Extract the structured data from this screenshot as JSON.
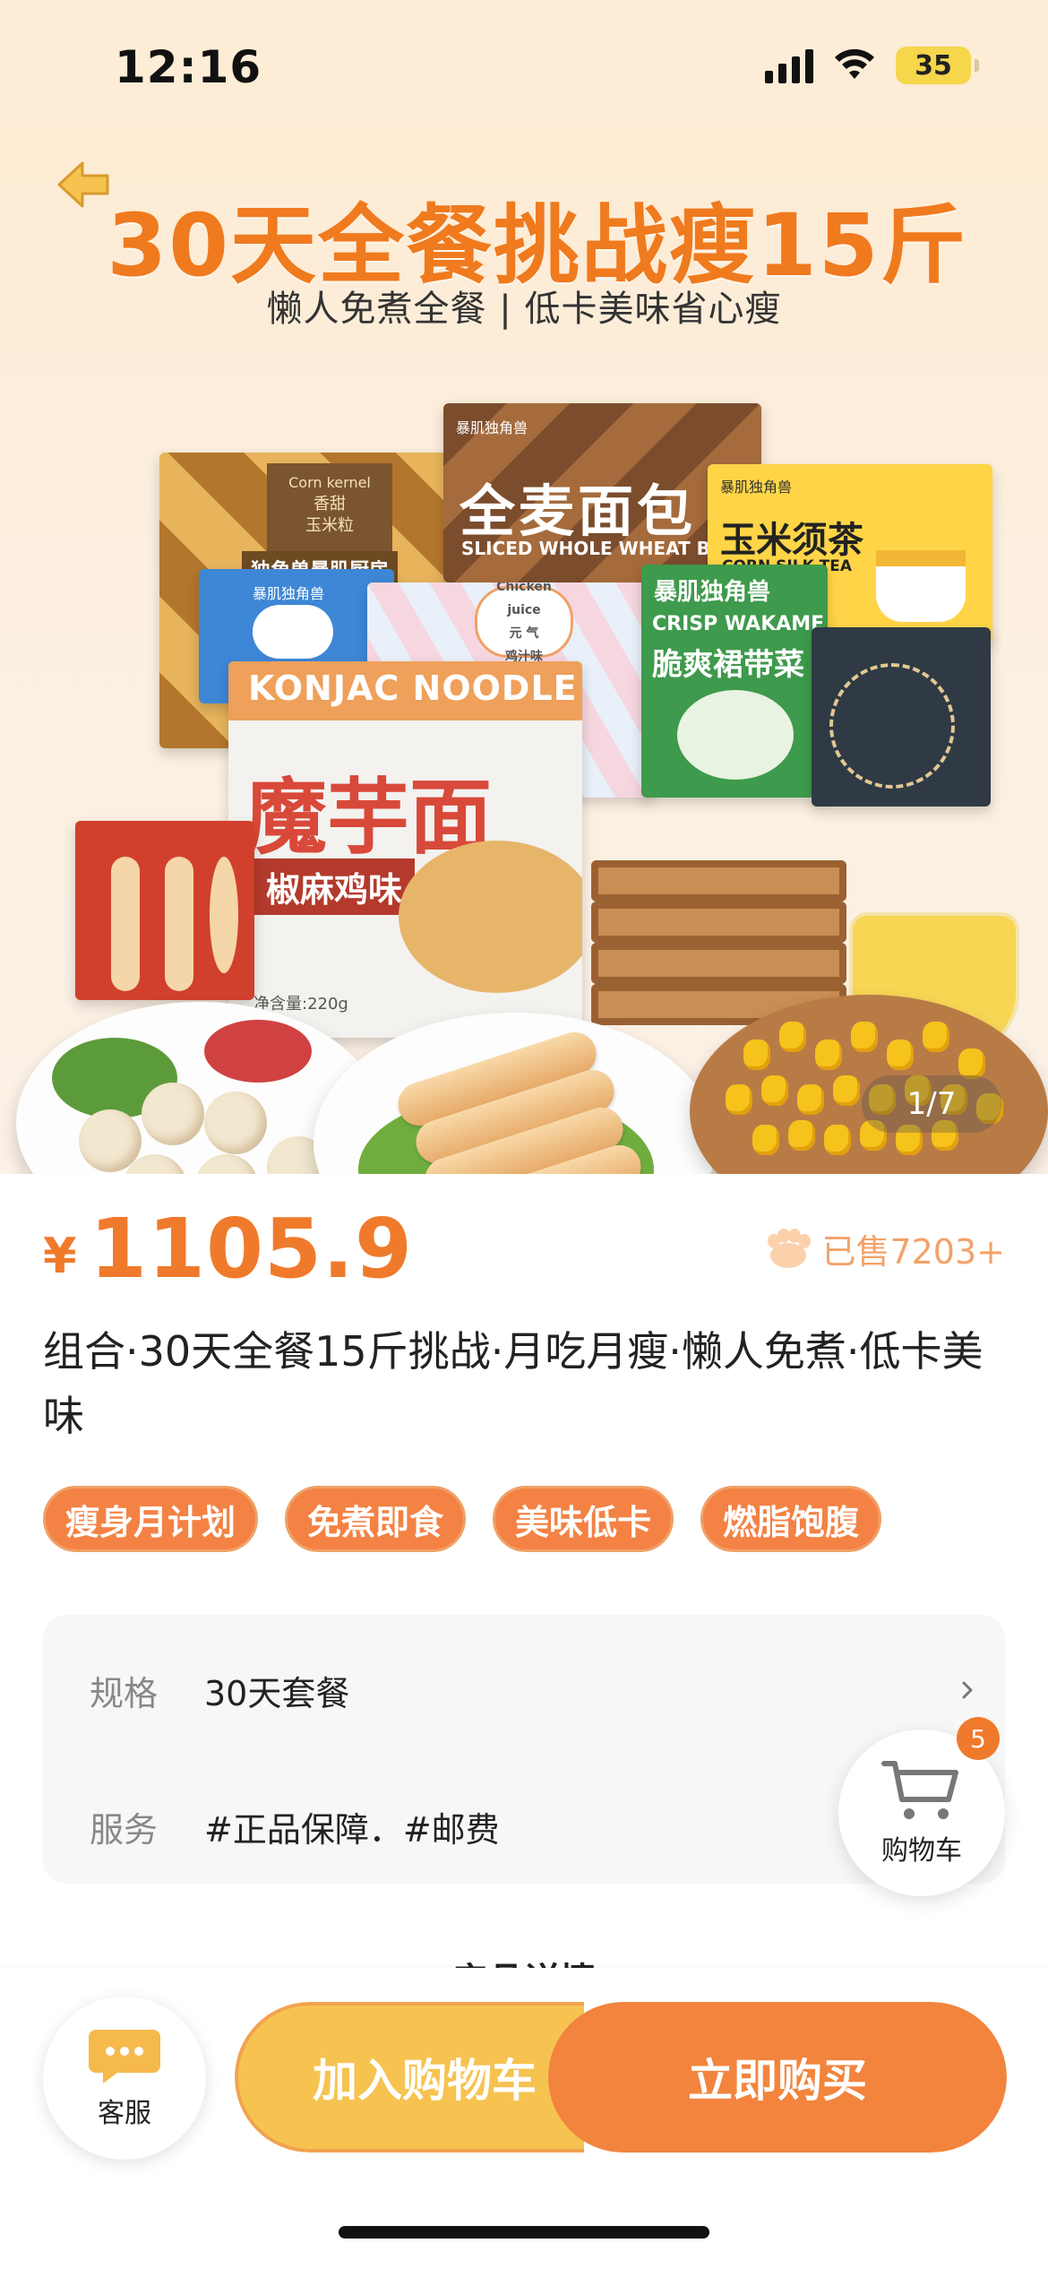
{
  "status_bar": {
    "time": "12:16",
    "battery": "35"
  },
  "banner": {
    "title": "30天全餐挑战瘦15斤",
    "subtitle": "懒人免煮全餐 | 低卡美味省心瘦",
    "packages": {
      "corn_top": "Corn kernel",
      "corn_name": "香甜\n玉米粒",
      "corn_brand": "独角兽暴肌厨房",
      "bread_brand": "暴肌独角兽",
      "bread_name": "全麦面包",
      "bread_en": "SLICED WHOLE WHEAT BREAD",
      "tea_brand": "暴肌独角兽",
      "tea_name": "玉米须茶",
      "tea_en": "CORN SILK TEA",
      "blue_brand": "暴肌独角兽",
      "chicken_tag": "Chicken juice\n元 气\n鸡汁味",
      "wakame_brand": "暴肌独角兽",
      "wakame_en": "CRISP WAKAME",
      "wakame_cn": "脆爽裙带菜",
      "konjac_en": "KONJAC NOODLE",
      "konjac_cn": "魔芋面",
      "konjac_flavor": "椒麻鸡味",
      "konjac_weight": "净含量:220g"
    },
    "page_indicator": "1/7"
  },
  "product": {
    "currency": "¥",
    "price": "1105.9",
    "sold": "已售7203+",
    "title": "组合·30天全餐15斤挑战·月吃月瘦·懒人免煮·低卡美味",
    "tags": [
      "瘦身月计划",
      "免煮即食",
      "美味低卡",
      "燃脂饱腹"
    ]
  },
  "specs": {
    "spec_key": "规格",
    "spec_value": "30天套餐",
    "service_key": "服务",
    "service_value": "#正品保障．#邮费"
  },
  "cart": {
    "label": "购物车",
    "badge": "5"
  },
  "section_next": "产品详情",
  "bottom_bar": {
    "service_label": "客服",
    "add_to_cart": "加入购物车",
    "buy_now": "立即购买"
  },
  "colors": {
    "accent": "#f07a2b",
    "add_cart": "#f6c351",
    "buy": "#f2843e"
  }
}
